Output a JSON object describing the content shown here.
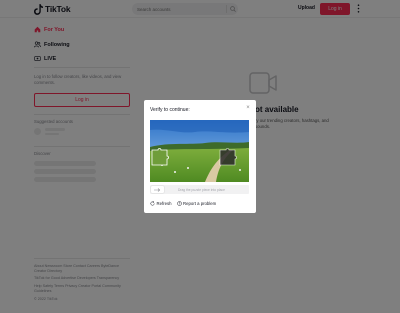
{
  "header": {
    "logo_text": "TikTok",
    "search_placeholder": "Search accounts",
    "upload_label": "Upload",
    "login_label": "Log in"
  },
  "sidebar": {
    "nav": [
      {
        "label": "For You",
        "icon": "home-icon",
        "active": true
      },
      {
        "label": "Following",
        "icon": "users-icon",
        "active": false
      },
      {
        "label": "LIVE",
        "icon": "live-icon",
        "active": false
      }
    ],
    "login_prompt": "Log in to follow creators, like videos, and view comments.",
    "login_button": "Log in",
    "suggested_title": "Suggested accounts",
    "discover_title": "Discover",
    "footer_lines": [
      "About Newsroom Store Contact Careers ByteDance Creator Directory",
      "TikTok for Good Advertise Developers Transparency",
      "Help Safety Terms Privacy Creator Portal Community Guidelines",
      "© 2022 TikTok"
    ]
  },
  "main": {
    "title": "ot available",
    "description": "ry our trending creators, hashtags, and sounds."
  },
  "captcha": {
    "title": "Verify to continue:",
    "close_label": "×",
    "slider_text": "Drag the puzzle piece into place",
    "refresh_label": "Refresh",
    "report_label": "Report a problem"
  },
  "colors": {
    "brand": "#fe2c55",
    "overlay": "rgba(0,0,0,0.5)"
  }
}
